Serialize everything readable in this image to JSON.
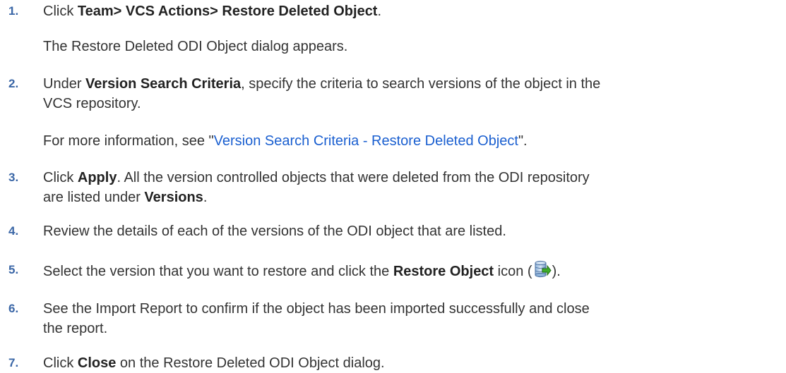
{
  "steps": [
    {
      "num": "1.",
      "pre": "Click ",
      "bold": "Team> VCS Actions> Restore Deleted Object",
      "post": ".",
      "sub": "The Restore Deleted ODI Object dialog appears."
    },
    {
      "num": "2.",
      "pre": "Under ",
      "bold": "Version Search Criteria",
      "post": ", specify the criteria to search versions of the object in the",
      "line2": "VCS repository.",
      "sub_pre": "For more information, see \"",
      "sub_link": "Version Search Criteria - Restore Deleted Object",
      "sub_post": "\"."
    },
    {
      "num": "3.",
      "pre": "Click ",
      "bold": "Apply",
      "post": ". All the version controlled objects that were deleted from the ODI repository",
      "line2_pre": "are listed under ",
      "line2_bold": "Versions",
      "line2_post": "."
    },
    {
      "num": "4.",
      "text": "Review the details of each of the versions of the ODI object that are listed."
    },
    {
      "num": "5.",
      "pre": "Select the version that you want to restore and click the ",
      "bold": "Restore Object",
      "post": " icon (",
      "icon": "restore-object-icon",
      "post2": ")."
    },
    {
      "num": "6.",
      "text": "See the Import Report to confirm if the object has been imported successfully and close",
      "line2": "the report."
    },
    {
      "num": "7.",
      "pre": "Click ",
      "bold": "Close",
      "post": " on the Restore Deleted ODI Object dialog."
    }
  ],
  "colors": {
    "text": "#333333",
    "step_number": "#3a66a6",
    "link": "#1a5fd0"
  }
}
